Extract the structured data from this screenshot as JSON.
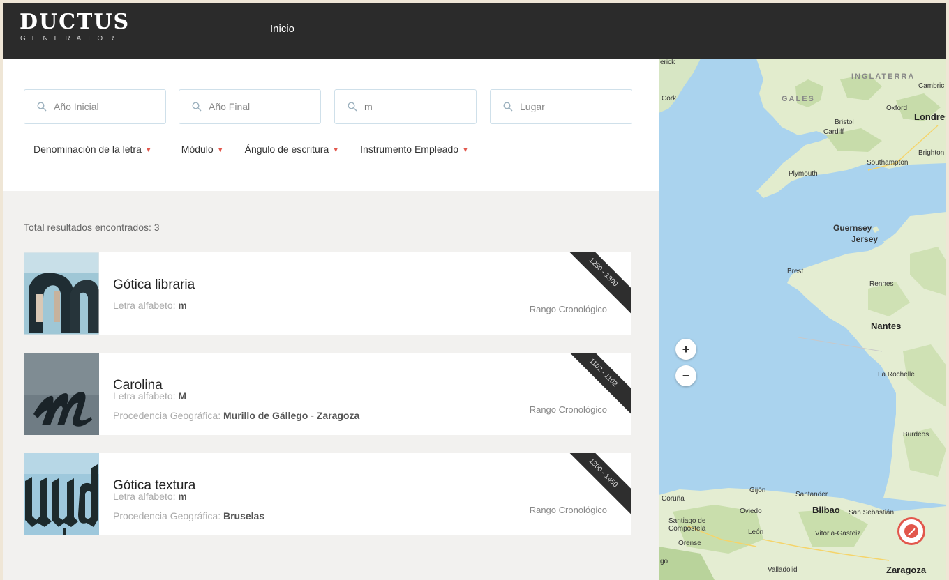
{
  "header": {
    "logo_main": "DUCTUS",
    "logo_sub": "GENERATOR",
    "nav_home": "Inicio"
  },
  "search": {
    "start_year_placeholder": "Año Inicial",
    "end_year_placeholder": "Año Final",
    "letter_value": "m",
    "place_placeholder": "Lugar"
  },
  "filters": [
    "Denominación de la letra",
    "Módulo",
    "Ángulo de escritura",
    "Instrumento Empleado"
  ],
  "results": {
    "total_label": "Total resultados encontrados: 3",
    "items": [
      {
        "title": "Gótica libraria",
        "letter_label": "Letra alfabeto:",
        "letter": "m",
        "range_label": "Rango Cronológico",
        "range": "1250 - 1300"
      },
      {
        "title": "Carolina",
        "letter_label": "Letra alfabeto:",
        "letter": "M",
        "origin_label": "Procedencia Geográfica:",
        "origin_place": "Murillo de Gállego",
        "origin_sep": "-",
        "origin_region": "Zaragoza",
        "range_label": "Rango Cronológico",
        "range": "1102 - 1102"
      },
      {
        "title": "Gótica textura",
        "letter_label": "Letra alfabeto:",
        "letter": "m",
        "origin_label": "Procedencia Geográfica:",
        "origin_place": "Bruselas",
        "range_label": "Rango Cronológico",
        "range": "1300 - 1450"
      }
    ]
  },
  "map": {
    "zoom_in": "+",
    "zoom_out": "−",
    "labels": {
      "inglaterra": "INGLATERRA",
      "gales": "GALES",
      "cambridge": "Cambric",
      "oxford": "Oxford",
      "londres": "Londres",
      "bristol": "Bristol",
      "cardiff": "Cardiff",
      "cork": "Cork",
      "brighton": "Brighton",
      "southampton": "Southampton",
      "plymouth": "Plymouth",
      "guernsey": "Guernsey",
      "jersey": "Jersey",
      "brest": "Brest",
      "rennes": "Rennes",
      "nantes": "Nantes",
      "la_rochelle": "La Rochelle",
      "burdeos": "Burdeos",
      "gijon": "Gijón",
      "santander": "Santander",
      "coruna": "Coruña",
      "oviedo": "Oviedo",
      "bilbao": "Bilbao",
      "san_sebastian": "San Sebastián",
      "santiago": "Santiago de Compostela",
      "leon": "León",
      "vitoria": "Vitoria-Gasteiz",
      "orense": "Orense",
      "valladolid": "Valladolid",
      "zaragoza": "Zaragoza",
      "top_cut": "erick",
      "left_cut": "go"
    }
  }
}
